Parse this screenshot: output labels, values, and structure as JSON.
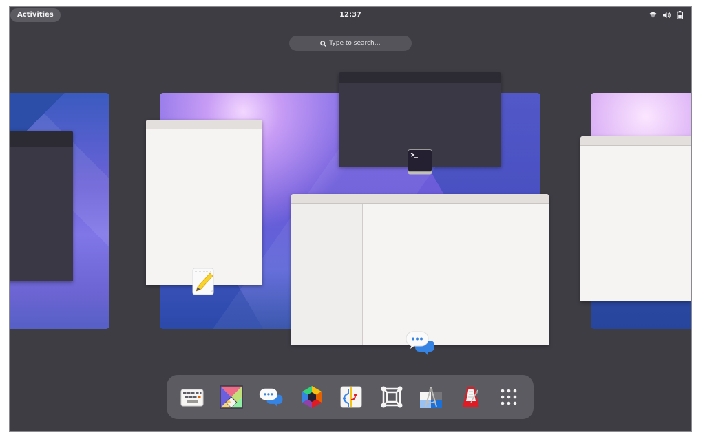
{
  "topbar": {
    "activities_label": "Activities",
    "clock": "12:37",
    "tray_icons": [
      "network-wireless-icon",
      "volume-icon",
      "battery-icon"
    ]
  },
  "search": {
    "placeholder": "Type to search…",
    "icon": "search-icon"
  },
  "overview": {
    "workspaces": [
      {
        "name": "workspace-previous",
        "windows": [
          "terminal-window"
        ]
      },
      {
        "name": "workspace-current",
        "windows": [
          {
            "app": "Text Editor",
            "icon": "text-editor-icon",
            "theme": "light"
          },
          {
            "app": "Terminal",
            "icon": "terminal-icon",
            "theme": "dark"
          },
          {
            "app": "Chat",
            "icon": "chat-icon",
            "theme": "light",
            "has_sidebar": true
          }
        ]
      },
      {
        "name": "workspace-next",
        "windows": [
          "light-window"
        ]
      }
    ]
  },
  "dock": {
    "items": [
      {
        "app": "Keyboard",
        "icon": "keyboard-icon"
      },
      {
        "app": "Tangram",
        "icon": "tangram-icon"
      },
      {
        "app": "Chat",
        "icon": "chat-icon"
      },
      {
        "app": "Color Picker",
        "icon": "color-wheel-icon"
      },
      {
        "app": "Git Client",
        "icon": "git-branch-icon"
      },
      {
        "app": "Vector Editor",
        "icon": "vector-frame-icon"
      },
      {
        "app": "Design Tool",
        "icon": "drafting-compass-icon"
      },
      {
        "app": "Metronome",
        "icon": "metronome-icon"
      },
      {
        "app": "Show Applications",
        "icon": "app-grid-icon"
      }
    ]
  },
  "colors": {
    "background": "#3e3d44",
    "panel_pill": "#5c5b62",
    "accent_blue": "#3584e4"
  }
}
